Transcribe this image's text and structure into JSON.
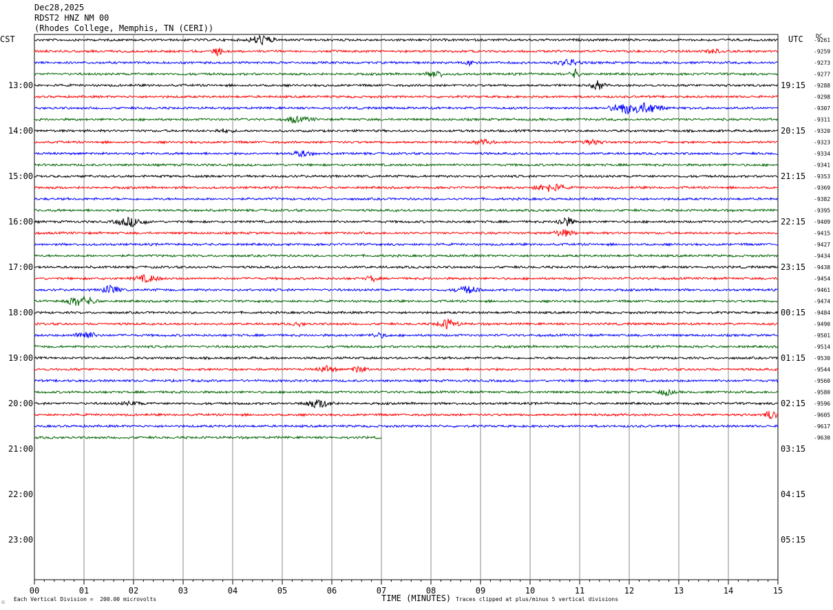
{
  "header": {
    "date": "Dec28,2025",
    "station": "RDST2 HNZ NM 00",
    "location": "(Rhodes College, Memphis, TN (CERI))"
  },
  "labels": {
    "left_zone": "CST",
    "right_zone": "UTC",
    "dc": "DC"
  },
  "footer": {
    "division": "Each Vertical Division =  200.00 microvolts",
    "clipped": "Traces clipped at plus/minus 5 vertical divisions",
    "logo": "☉"
  },
  "chart_data": {
    "type": "line",
    "title": "",
    "xlabel": "TIME (MINUTES)",
    "ylabel": "",
    "xlim": [
      0,
      15
    ],
    "x_ticks": [
      "00",
      "01",
      "02",
      "03",
      "04",
      "05",
      "06",
      "07",
      "08",
      "09",
      "10",
      "11",
      "12",
      "13",
      "14",
      "15"
    ],
    "left_hour_labels": [
      "13:00",
      "14:00",
      "15:00",
      "16:00",
      "17:00",
      "18:00",
      "19:00",
      "20:00",
      "21:00",
      "22:00",
      "23:00"
    ],
    "right_hour_labels": [
      "19:15",
      "20:15",
      "21:15",
      "22:15",
      "23:15",
      "00:15",
      "01:15",
      "02:15",
      "03:15",
      "04:15",
      "05:15"
    ],
    "trace_colors": [
      "#000000",
      "#ff0000",
      "#0000ff",
      "#006400"
    ],
    "traces_per_hour": 4,
    "minutes_per_trace": 15,
    "last_trace_end_minute": 7,
    "dc_offsets": [
      "-9261",
      "-9259",
      "-9273",
      "-9277",
      "-9288",
      "-9298",
      "-9307",
      "-9311",
      "-9320",
      "-9323",
      "-9334",
      "-9341",
      "-9353",
      "-9369",
      "-9382",
      "-9395",
      "-9409",
      "-9415",
      "-9427",
      "-9434",
      "-9438",
      "-9454",
      "-9461",
      "-9474",
      "-9484",
      "-9490",
      "-9501",
      "-9514",
      "-9530",
      "-9544",
      "-9560",
      "-9580",
      "-9596",
      "-9605",
      "-9617",
      "-9630"
    ],
    "grid": true
  }
}
